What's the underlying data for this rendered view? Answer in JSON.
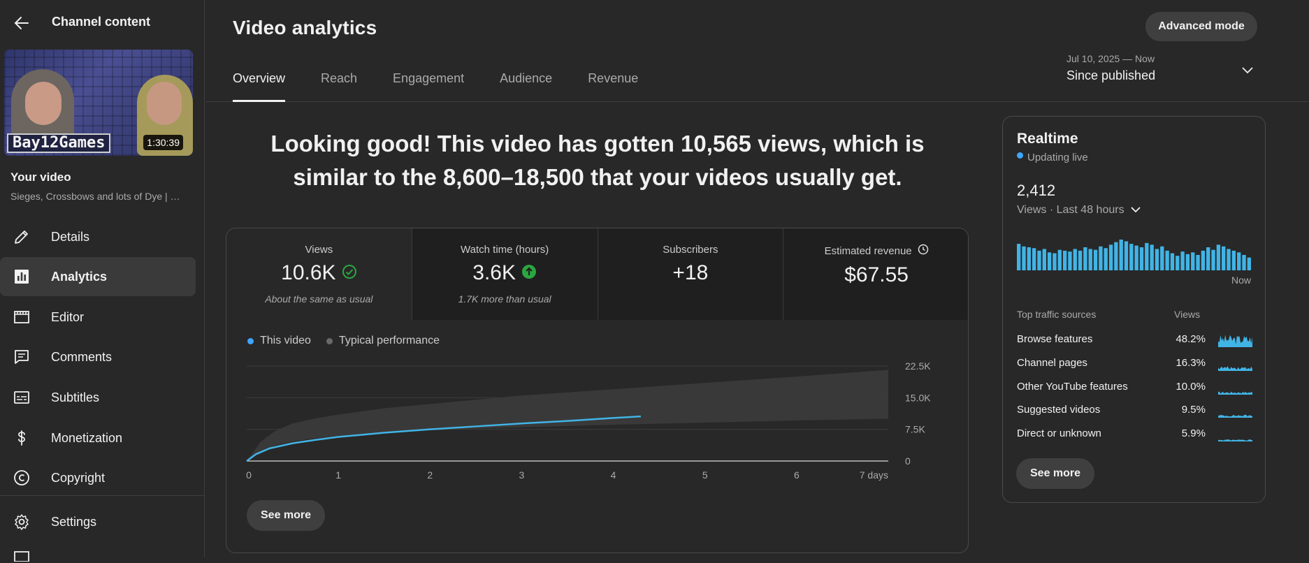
{
  "sidebar": {
    "title": "Channel content",
    "thumbnail": {
      "brand": "Bay12Games",
      "duration": "1:30:39"
    },
    "your_video_label": "Your video",
    "video_title": "Sieges, Crossbows and lots of Dye | …",
    "items": [
      {
        "label": "Details",
        "icon": "pencil-icon"
      },
      {
        "label": "Analytics",
        "icon": "analytics-icon",
        "active": true
      },
      {
        "label": "Editor",
        "icon": "editor-icon"
      },
      {
        "label": "Comments",
        "icon": "comments-icon"
      },
      {
        "label": "Subtitles",
        "icon": "subtitles-icon"
      },
      {
        "label": "Monetization",
        "icon": "dollar-icon"
      },
      {
        "label": "Copyright",
        "icon": "copyright-icon"
      }
    ],
    "settings_label": "Settings"
  },
  "header": {
    "title": "Video analytics",
    "advanced_mode": "Advanced mode",
    "tabs": [
      "Overview",
      "Reach",
      "Engagement",
      "Audience",
      "Revenue"
    ],
    "active_tab": "Overview",
    "range_dates": "Jul 10, 2025 — Now",
    "range_label": "Since published"
  },
  "headline": "Looking good! This video has gotten 10,565 views, which is similar to the 8,600–18,500 that your videos usually get.",
  "metrics": [
    {
      "label": "Views",
      "value": "10.6K",
      "note": "About the same as usual",
      "badge": "check-circle-icon"
    },
    {
      "label": "Watch time (hours)",
      "value": "3.6K",
      "note": "1.7K more than usual",
      "badge": "arrow-up-circle-icon"
    },
    {
      "label": "Subscribers",
      "value": "+18",
      "note": ""
    },
    {
      "label": "Estimated revenue",
      "value": "$67.55",
      "note": "",
      "label_icon": "clock-icon"
    }
  ],
  "legend": {
    "this_video": "This video",
    "typical": "Typical performance"
  },
  "see_more": "See more",
  "colors": {
    "accent": "#3ea6ff",
    "line": "#41b4e6",
    "good": "#2ba640",
    "band": "#3a3a3a"
  },
  "chart_data": {
    "type": "line",
    "x_tick_labels": [
      "0",
      "1",
      "2",
      "3",
      "4",
      "5",
      "6",
      "7 days"
    ],
    "y_tick_labels": [
      "0",
      "7.5K",
      "15.0K",
      "22.5K"
    ],
    "xlim": [
      0,
      7
    ],
    "ylim": [
      0,
      22500
    ],
    "series": [
      {
        "name": "This video",
        "x": [
          0,
          0.1,
          0.25,
          0.5,
          0.75,
          1,
          1.5,
          2,
          2.5,
          3,
          3.5,
          4,
          4.3
        ],
        "y": [
          0,
          1600,
          3000,
          4200,
          5000,
          5700,
          6700,
          7500,
          8200,
          8900,
          9500,
          10200,
          10565
        ]
      },
      {
        "name": "Typical performance",
        "x": [
          0,
          0.15,
          0.3,
          0.5,
          0.75,
          1,
          1.5,
          2,
          3,
          4,
          5,
          6,
          7
        ],
        "lower": [
          0,
          2200,
          3600,
          4600,
          5400,
          5900,
          6700,
          7300,
          8000,
          8600,
          9100,
          9600,
          10000
        ],
        "upper": [
          0,
          4500,
          7000,
          8900,
          10100,
          11000,
          12500,
          13500,
          15500,
          17000,
          18500,
          20000,
          21600
        ]
      }
    ]
  },
  "realtime": {
    "title": "Realtime",
    "live": "Updating live",
    "value": "2,412",
    "period": "Views · Last 48 hours",
    "now": "Now",
    "bars": [
      31,
      28,
      27,
      26,
      23,
      25,
      21,
      20,
      24,
      23,
      22,
      25,
      23,
      27,
      25,
      24,
      28,
      26,
      30,
      33,
      36,
      34,
      31,
      29,
      27,
      32,
      30,
      25,
      28,
      23,
      20,
      17,
      22,
      19,
      21,
      18,
      23,
      27,
      24,
      30,
      28,
      25,
      23,
      21,
      18,
      15
    ],
    "top_sources_label": "Top traffic sources",
    "views_label": "Views",
    "sources": [
      {
        "name": "Browse features",
        "pct": "48.2%"
      },
      {
        "name": "Channel pages",
        "pct": "16.3%"
      },
      {
        "name": "Other YouTube features",
        "pct": "10.0%"
      },
      {
        "name": "Suggested videos",
        "pct": "9.5%"
      },
      {
        "name": "Direct or unknown",
        "pct": "5.9%"
      }
    ],
    "see_more": "See more"
  }
}
